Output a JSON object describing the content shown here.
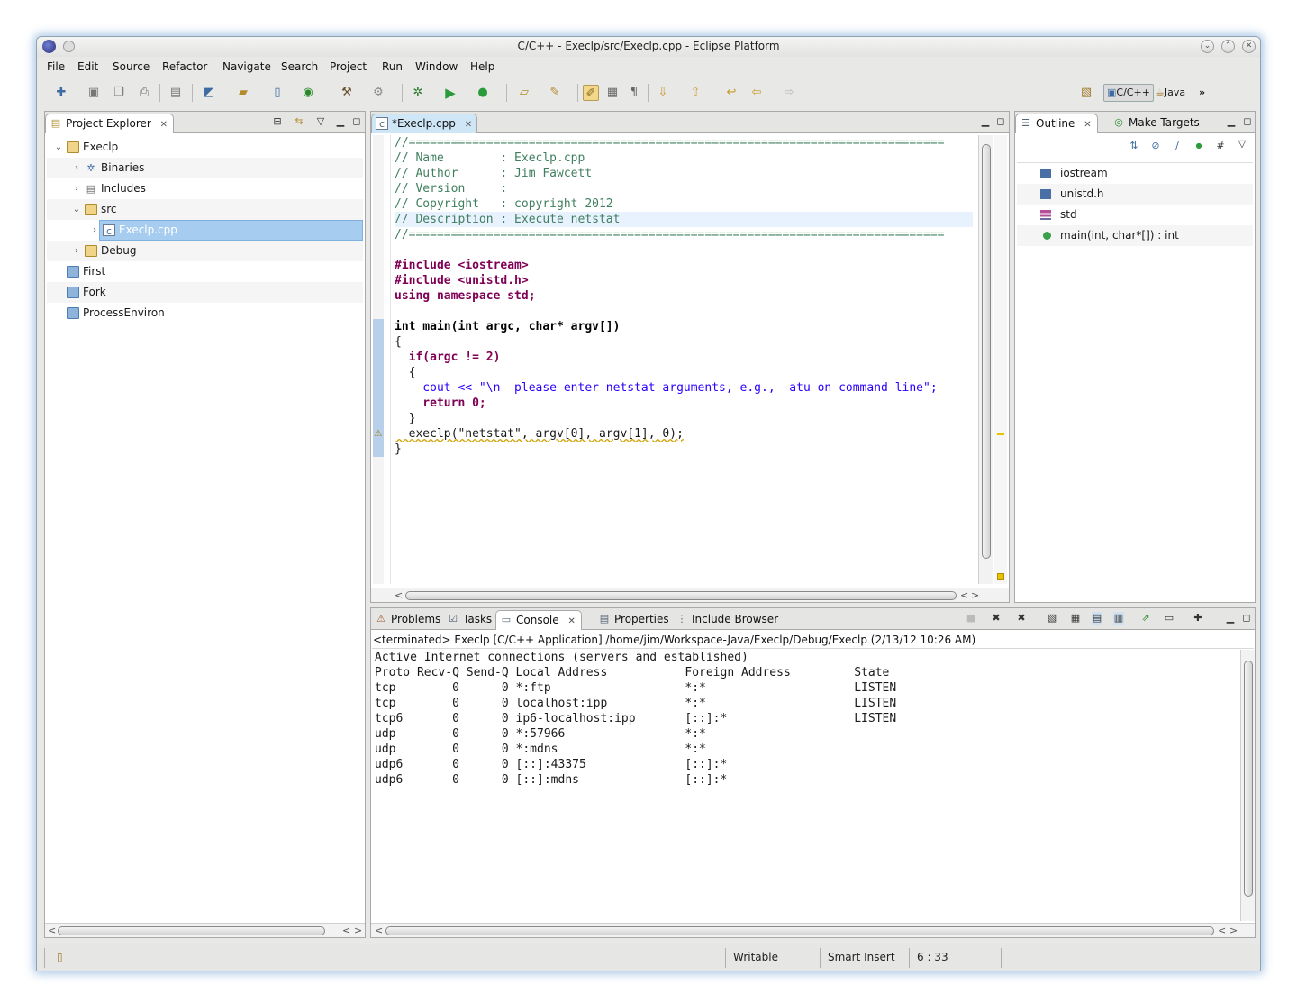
{
  "window": {
    "title": "C/C++ - Execlp/src/Execlp.cpp - Eclipse Platform"
  },
  "menu": [
    "File",
    "Edit",
    "Source",
    "Refactor",
    "Navigate",
    "Search",
    "Project",
    "Run",
    "Window",
    "Help"
  ],
  "perspectives": {
    "cpp_label": "C/C++",
    "java_label": "Java",
    "more": "»"
  },
  "project_explorer": {
    "tab_label": "Project Explorer",
    "tree": [
      {
        "label": "Execlp",
        "indent": 0,
        "expanded": true,
        "icon": "project-icon"
      },
      {
        "label": "Binaries",
        "indent": 1,
        "expanded": false,
        "icon": "binaries-icon"
      },
      {
        "label": "Includes",
        "indent": 1,
        "expanded": false,
        "icon": "includes-icon"
      },
      {
        "label": "src",
        "indent": 1,
        "expanded": true,
        "icon": "source-folder-icon"
      },
      {
        "label": "Execlp.cpp",
        "indent": 2,
        "expanded": false,
        "icon": "cpp-file-icon",
        "selected": true
      },
      {
        "label": "Debug",
        "indent": 1,
        "expanded": false,
        "icon": "folder-open-icon"
      },
      {
        "label": "First",
        "indent": 0,
        "icon": "closed-project-icon"
      },
      {
        "label": "Fork",
        "indent": 0,
        "icon": "closed-project-icon"
      },
      {
        "label": "ProcessEnviron",
        "indent": 0,
        "icon": "closed-project-icon"
      }
    ]
  },
  "editor": {
    "tab_label": "*Execlp.cpp",
    "lines": [
      "//============================================================================",
      "// Name        : Execlp.cpp",
      "// Author      : Jim Fawcett",
      "// Version     :",
      "// Copyright   : copyright 2012",
      "// Description : Execute netstat",
      "//============================================================================",
      "",
      "#include <iostream>",
      "#include <unistd.h>",
      "using namespace std;",
      "",
      "int main(int argc, char* argv[])",
      "{",
      "  if(argc != 2)",
      "  {",
      "    cout << \"\\n  please enter netstat arguments, e.g., -atu on command line\";",
      "    return 0;",
      "  }",
      "  execlp(\"netstat\", argv[0], argv[1], 0);",
      "}"
    ]
  },
  "outline": {
    "tab_label": "Outline",
    "make_targets_label": "Make Targets",
    "items": [
      {
        "label": "iostream",
        "icon": "include-icon"
      },
      {
        "label": "unistd.h",
        "icon": "include-icon"
      },
      {
        "label": "std",
        "icon": "namespace-icon"
      },
      {
        "label": "main(int, char*[]) : int",
        "icon": "function-warning-icon"
      }
    ]
  },
  "bottom_tabs": {
    "problems": "Problems",
    "tasks": "Tasks",
    "console": "Console",
    "properties": "Properties",
    "include_browser": "Include Browser"
  },
  "console": {
    "header": "<terminated> Execlp [C/C++ Application] /home/jim/Workspace-Java/Execlp/Debug/Execlp (2/13/12 10:26 AM)",
    "lines": [
      "Active Internet connections (servers and established)",
      "Proto Recv-Q Send-Q Local Address           Foreign Address         State",
      "tcp        0      0 *:ftp                   *:*                     LISTEN",
      "tcp        0      0 localhost:ipp           *:*                     LISTEN",
      "tcp6       0      0 ip6-localhost:ipp       [::]:*                  LISTEN",
      "udp        0      0 *:57966                 *:*",
      "udp        0      0 *:mdns                  *:*",
      "udp6       0      0 [::]:43375              [::]:*",
      "udp6       0      0 [::]:mdns               [::]:*"
    ]
  },
  "status": {
    "writable": "Writable",
    "insert_mode": "Smart Insert",
    "position": "6 : 33"
  },
  "colors": {
    "accent": "#9ec6ea",
    "comment": "#3f7f5f",
    "keyword": "#7f0055",
    "string": "#2a00ff"
  }
}
